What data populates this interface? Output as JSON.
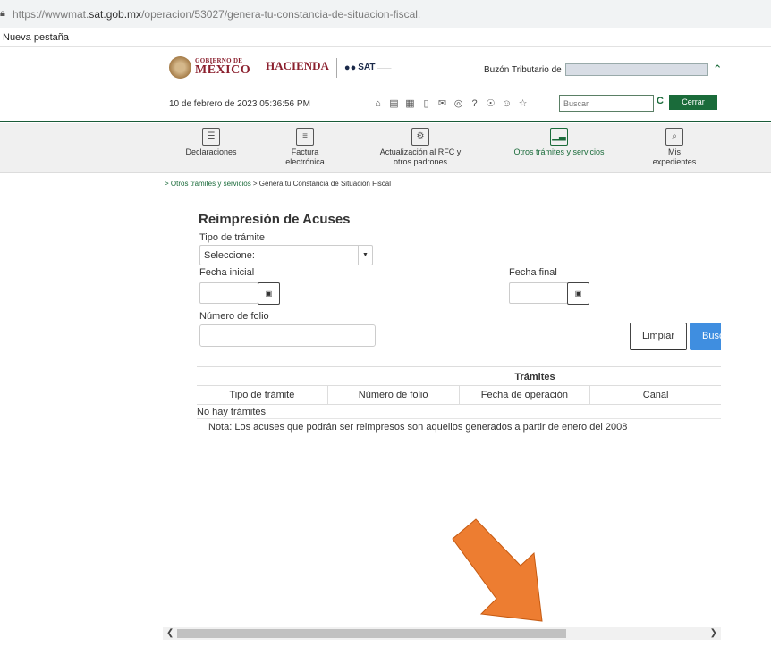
{
  "browser": {
    "url_prefix": "https://wwwmat.",
    "url_domain": "sat.gob.mx",
    "url_path": "/operacion/53027/genera-tu-constancia-de-situacion-fiscal.",
    "bookmark": "Nueva pestaña"
  },
  "header": {
    "gob_line1": "GOBIERNO DE",
    "gob_line2": "MÉXICO",
    "hacienda": "HACIENDA",
    "sat": "SAT",
    "buzon_label": "Buzón Tributario de"
  },
  "toolbar": {
    "date": "10 de febrero de 2023 05:36:56 PM",
    "search_placeholder": "Buscar",
    "logout": "Cerrar sesión"
  },
  "nav": {
    "items": [
      {
        "label1": "Declaraciones",
        "label2": ""
      },
      {
        "label1": "Factura",
        "label2": "electrónica"
      },
      {
        "label1": "Actualización al RFC y",
        "label2": "otros padrones"
      },
      {
        "label1": "Otros trámites y servicios",
        "label2": ""
      },
      {
        "label1": "Mis",
        "label2": "expedientes"
      }
    ]
  },
  "breadcrumb": {
    "link": "> Otros trámites y servicios",
    "current": " > Genera tu Constancia de Situación Fiscal"
  },
  "form": {
    "title": "Reimpresión de Acuses",
    "tipo_label": "Tipo de trámite",
    "tipo_value": "Seleccione:",
    "fecha_inicial_label": "Fecha inicial",
    "fecha_final_label": "Fecha final",
    "folio_label": "Número de folio",
    "limpiar": "Limpiar",
    "buscar": "Buscar"
  },
  "table": {
    "title": "Trámites",
    "columns": [
      "Tipo de trámite",
      "Número de folio",
      "Fecha de operación",
      "Canal"
    ],
    "empty": "No hay trámites",
    "note": "Nota: Los acuses que podrán ser reimpresos son aquellos generados a partir de enero del 2008"
  },
  "colors": {
    "accent_green": "#1a6b3a",
    "button_blue": "#3f8ee0",
    "annotation_arrow": "#ed7d31"
  }
}
